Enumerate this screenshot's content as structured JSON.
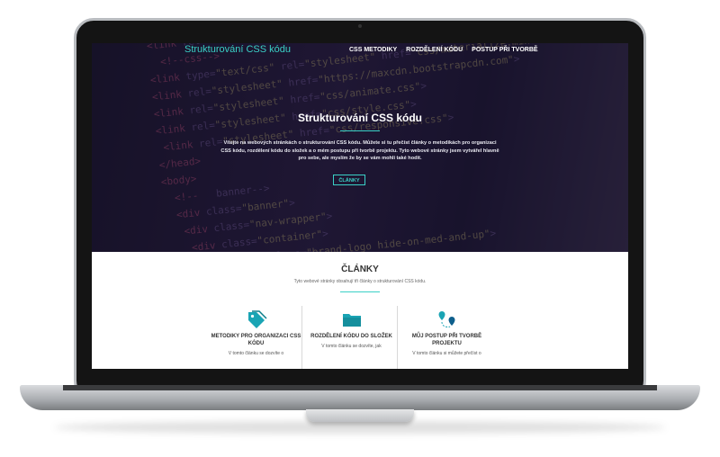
{
  "site": {
    "brand": "Strukturování CSS kódu",
    "nav": [
      "CSS METODIKY",
      "ROZDĚLENÍ KÓDU",
      "POSTUP PŘI TVORBĚ"
    ]
  },
  "hero": {
    "title": "Strukturování CSS kódu",
    "text": "Vítejte na webových stránkách o strukturování CSS kódu. Můžete si tu přečíst články o metodikách pro organizaci CSS kódu, rozdělení kódu do složek a o mém postupu při tvorbě projektu. Tyto webové stránky jsem vytvářel hlavně pro sebe, ale myslím že by se vám mohli také hodit.",
    "button": "ČLÁNKY"
  },
  "articles": {
    "title": "ČLÁNKY",
    "subtitle": "Tyto webové stránky obsahují tři články o strukturování CSS kódu.",
    "cards": [
      {
        "icon": "tag-icon",
        "title": "METODIKY PRO ORGANIZACI CSS KÓDU",
        "text": "V tomto článku se dozvíte o"
      },
      {
        "icon": "folder-icon",
        "title": "ROZDĚLENÍ KÓDU DO SLOŽEK",
        "text": "V tomto článku se dozvíte, jak"
      },
      {
        "icon": "route-icon",
        "title": "MŮJ POSTUP PŘI TVORBĚ PROJEKTU",
        "text": "V tomto článku si můžete přečíst o"
      }
    ]
  },
  "colors": {
    "accent": "#3ad0c6",
    "hero_bg": "#1b1630",
    "icon": "#1aa4b4"
  }
}
